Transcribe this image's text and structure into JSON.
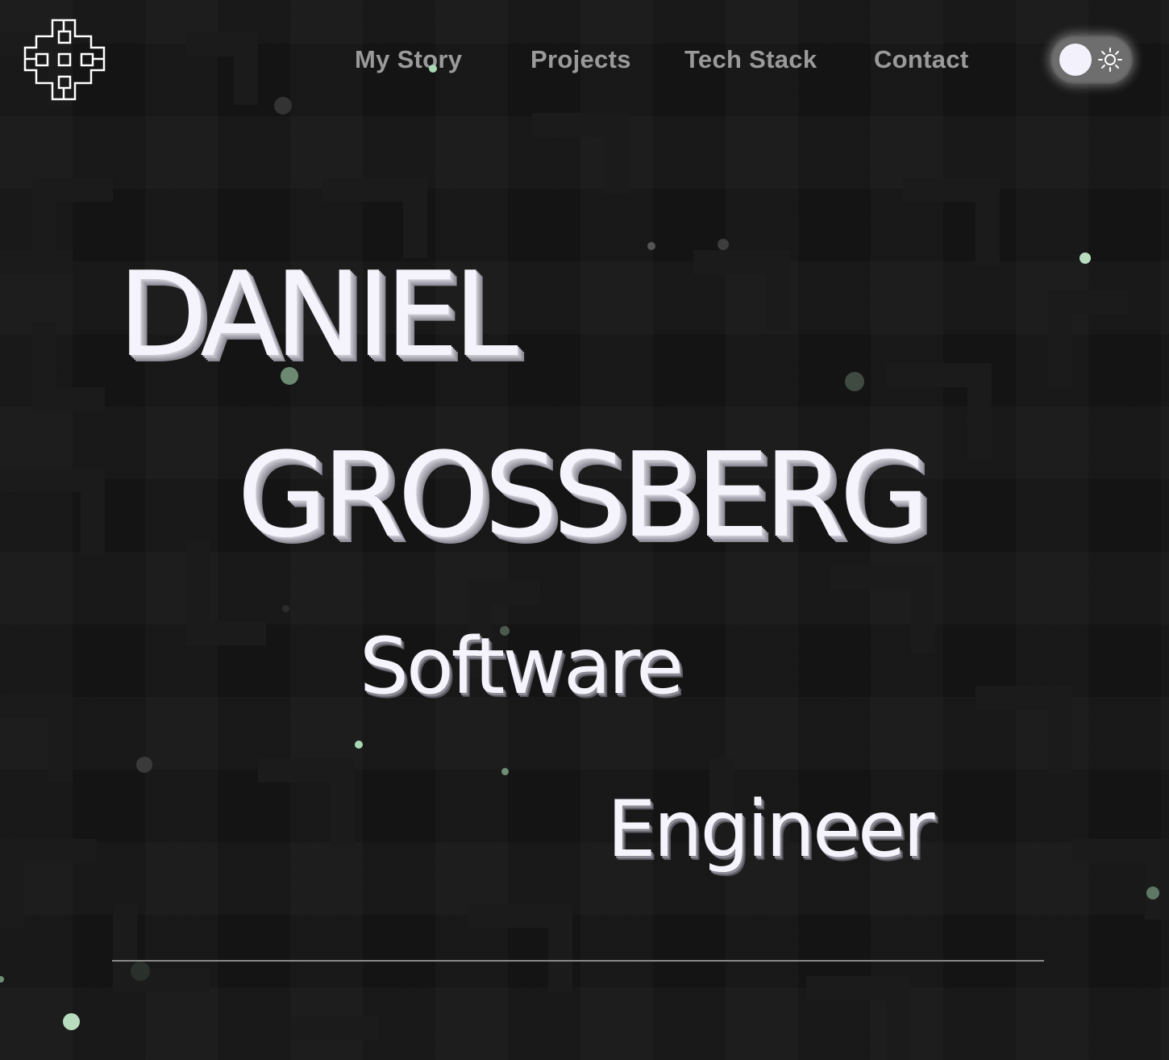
{
  "nav": {
    "items": [
      {
        "label": "My Story"
      },
      {
        "label": "Projects"
      },
      {
        "label": "Tech Stack"
      },
      {
        "label": "Contact"
      }
    ]
  },
  "theme_toggle": {
    "state": "dark",
    "icon": "sun-icon"
  },
  "hero": {
    "first_name": "DANIEL",
    "last_name": "GROSSBERG",
    "role_line_1": "Software",
    "role_line_2": "Engineer"
  },
  "colors": {
    "background": "#141414",
    "text": "#f5f3fb",
    "nav_text": "#9a9a9a",
    "particle_light": "#b8dcc0",
    "particle_dark": "#3a3a3a"
  }
}
